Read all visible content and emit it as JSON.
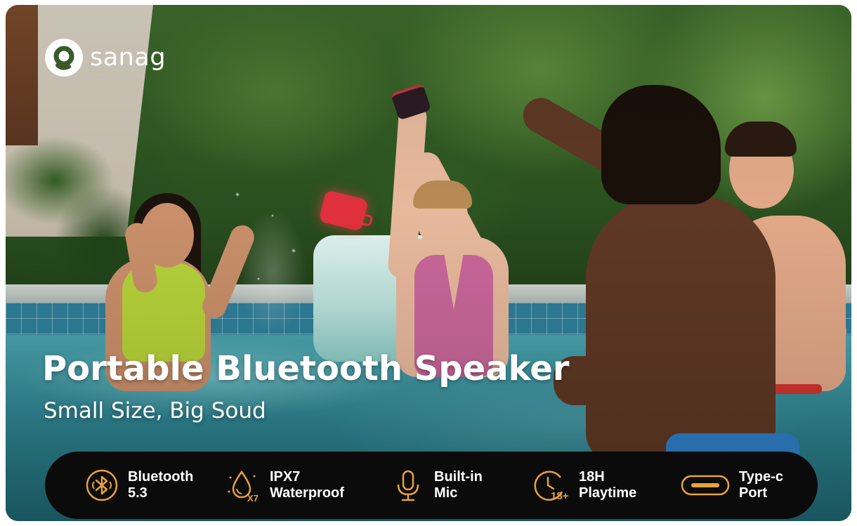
{
  "brand": {
    "name": "sanag",
    "icon": "sanag-logo-icon"
  },
  "headline": "Portable Bluetooth Speaker",
  "subheadline": "Small Size, Big Soud",
  "colors": {
    "accent": "#e9a23a",
    "bar_background": "#0b0b0b",
    "text": "#ffffff"
  },
  "features": [
    {
      "icon": "bluetooth-icon",
      "line1": "Bluetooth",
      "line2": "5.3"
    },
    {
      "icon": "water-drop-icon",
      "icon_text": "X7",
      "line1": "IPX7",
      "line2": "Waterproof"
    },
    {
      "icon": "microphone-icon",
      "line1": "Built-in",
      "line2": "Mic"
    },
    {
      "icon": "clock-icon",
      "icon_text": "18+",
      "line1": "18H",
      "line2": "Playtime"
    },
    {
      "icon": "usb-c-port-icon",
      "line1": "Type-c",
      "line2": "Port"
    }
  ]
}
